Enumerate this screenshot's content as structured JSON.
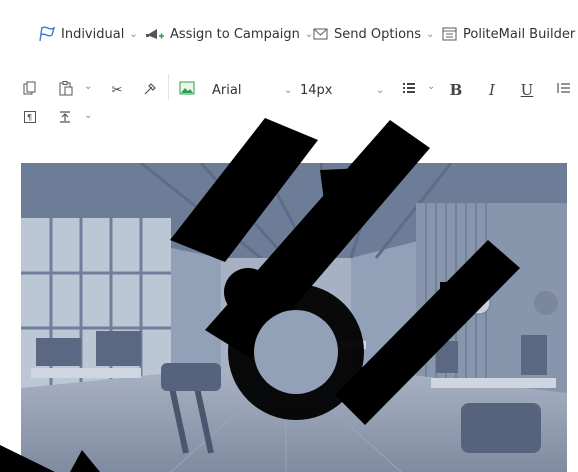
{
  "ribbon": {
    "individual_label": "Individual",
    "assign_label": "Assign to Campaign",
    "send_options_label": "Send Options",
    "politemail_label": "PoliteMail Builder"
  },
  "toolbar": {
    "font_family": "Arial",
    "font_size": "14px",
    "bold": "B",
    "italic": "I",
    "underline": "U"
  },
  "icons": {
    "individual": "flag-icon",
    "assign": "campaign-icon",
    "send_options": "envelope-icon",
    "politemail": "builder-icon",
    "copy": "copy-icon",
    "paste": "paste-icon",
    "cut": "cut-icon",
    "format_painter": "format-painter-icon",
    "insert_image": "image-icon",
    "list": "list-icon",
    "align": "align-icon",
    "paragraph": "paragraph-icon",
    "line_spacing": "line-spacing-icon"
  },
  "colors": {
    "accent": "#3a7bd5",
    "image_green": "#2e9e4f",
    "watermark": "#000000"
  }
}
